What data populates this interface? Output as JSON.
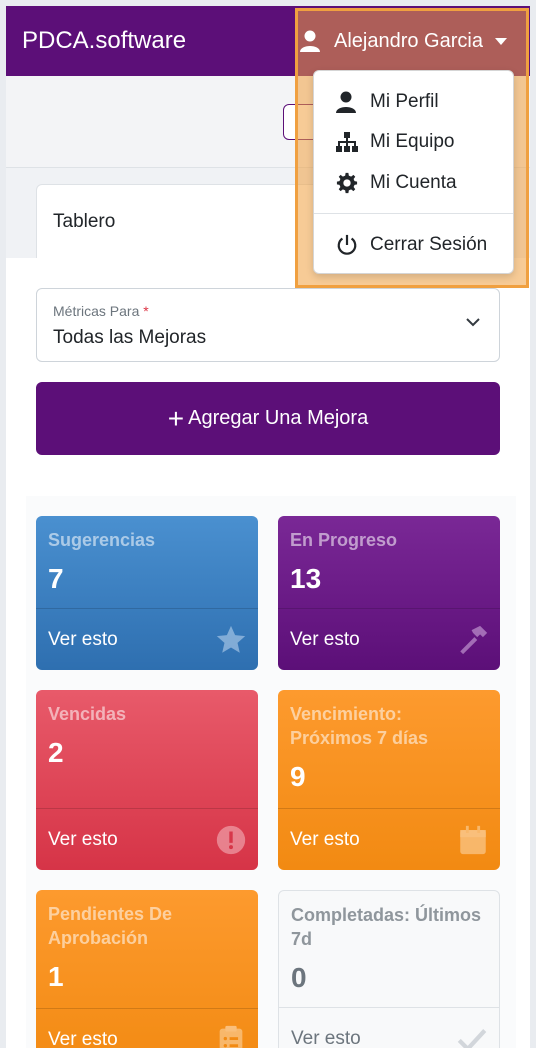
{
  "app": {
    "brand": "PDCA.software"
  },
  "user": {
    "name": "Alejandro Garcia"
  },
  "dropdown": {
    "items": [
      {
        "label": "Mi Perfil",
        "icon": "user-icon"
      },
      {
        "label": "Mi Equipo",
        "icon": "sitemap-icon"
      },
      {
        "label": "Mi Cuenta",
        "icon": "gear-icon"
      },
      {
        "label": "Cerrar Sesión",
        "icon": "power-icon"
      }
    ]
  },
  "tabs": {
    "active": "Tablero"
  },
  "filter": {
    "label": "Métricas Para",
    "required_mark": "*",
    "value": "Todas las Mejoras"
  },
  "actions": {
    "add_plus": "+",
    "add_label": "Agregar Una Mejora"
  },
  "cards": [
    {
      "title": "Sugerencias",
      "count": "7",
      "link": "Ver esto",
      "icon": "star-icon",
      "color": "#3a7fc1"
    },
    {
      "title": "En Progreso",
      "count": "13",
      "link": "Ver esto",
      "icon": "hammer-icon",
      "color": "#6a1b86"
    },
    {
      "title": "Vencidas",
      "count": "2",
      "link": "Ver esto",
      "icon": "exclamation-circle-icon",
      "color": "#dc3545"
    },
    {
      "title": "Vencimiento: Próximos 7 días",
      "count": "9",
      "link": "Ver esto",
      "icon": "calendar-icon",
      "color": "#f7901e"
    },
    {
      "title": "Pendientes De Aprobación",
      "count": "1",
      "link": "Ver esto",
      "icon": "clipboard-list-icon",
      "color": "#f7901e"
    },
    {
      "title": "Completadas: Últimos 7d",
      "count": "0",
      "link": "Ver esto",
      "icon": "check-icon",
      "color": "#f8f9fa"
    }
  ],
  "colors": {
    "primary": "#5c0f78",
    "highlight": "#f0a040"
  }
}
